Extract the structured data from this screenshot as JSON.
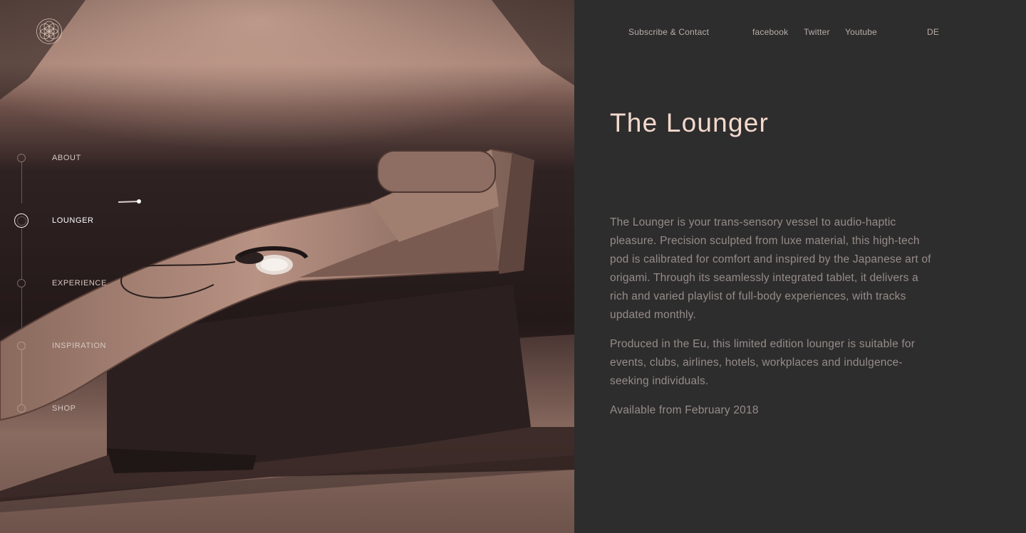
{
  "nav": {
    "items": [
      {
        "label": "ABOUT",
        "active": false
      },
      {
        "label": "LOUNGER",
        "active": true
      },
      {
        "label": "EXPERIENCE",
        "active": false
      },
      {
        "label": "INSPIRATION",
        "active": false
      },
      {
        "label": "SHOP",
        "active": false
      }
    ]
  },
  "topbar": {
    "subscribe": "Subscribe & Contact",
    "facebook": "facebook",
    "twitter": "Twitter",
    "youtube": "Youtube",
    "language": "DE"
  },
  "content": {
    "title": "The Lounger",
    "paragraphs": [
      "The Lounger is your trans-sensory vessel to audio-haptic pleasure. Precision sculpted from luxe material, this high-tech pod is calibrated for comfort and inspired by the Japanese art of origami. Through its seamlessly integrated tablet, it delivers a rich and varied playlist of full-body experiences, with tracks updated monthly.",
      "Produced in the Eu, this limited edition lounger is suitable for events, clubs, airlines, hotels, workplaces and indulgence-seeking individuals.",
      "Available from February 2018"
    ]
  },
  "colors": {
    "panel_bg": "#2e2d2d",
    "title": "#f3d9cd",
    "body_text": "#958c8a",
    "hero_tint": "#c49a87"
  },
  "icons": {
    "logo": "flower-of-life-logo-icon"
  }
}
